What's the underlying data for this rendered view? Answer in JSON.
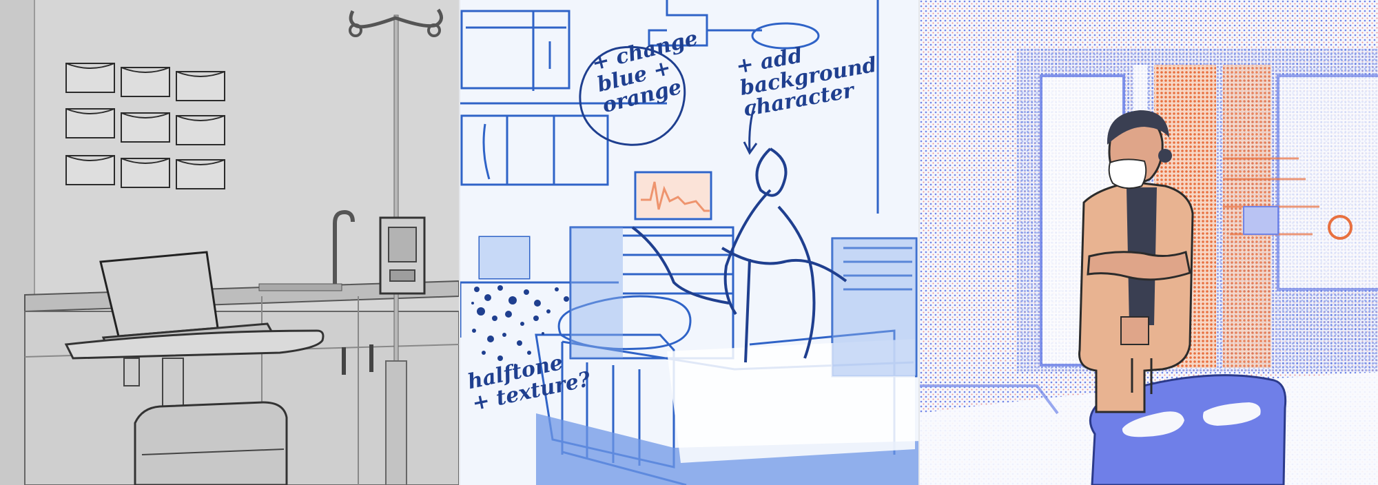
{
  "annotations": {
    "change_colors": "+ change\nblue +\norange",
    "add_character": "+ add background\ncharacter",
    "halftone": "halftone\n+ texture?"
  },
  "colors": {
    "render_bg": "#d9d9d9",
    "sketch_blue": "#2f63c7",
    "ink": "#1f3f8f",
    "accent_orange": "#e8703f",
    "halftone_blue": "#6f84e8",
    "skin": "#dfa589",
    "coat": "#e8b391"
  },
  "panels": [
    {
      "stage": "3d-render"
    },
    {
      "stage": "blue-sketch"
    },
    {
      "stage": "final-halftone"
    }
  ]
}
